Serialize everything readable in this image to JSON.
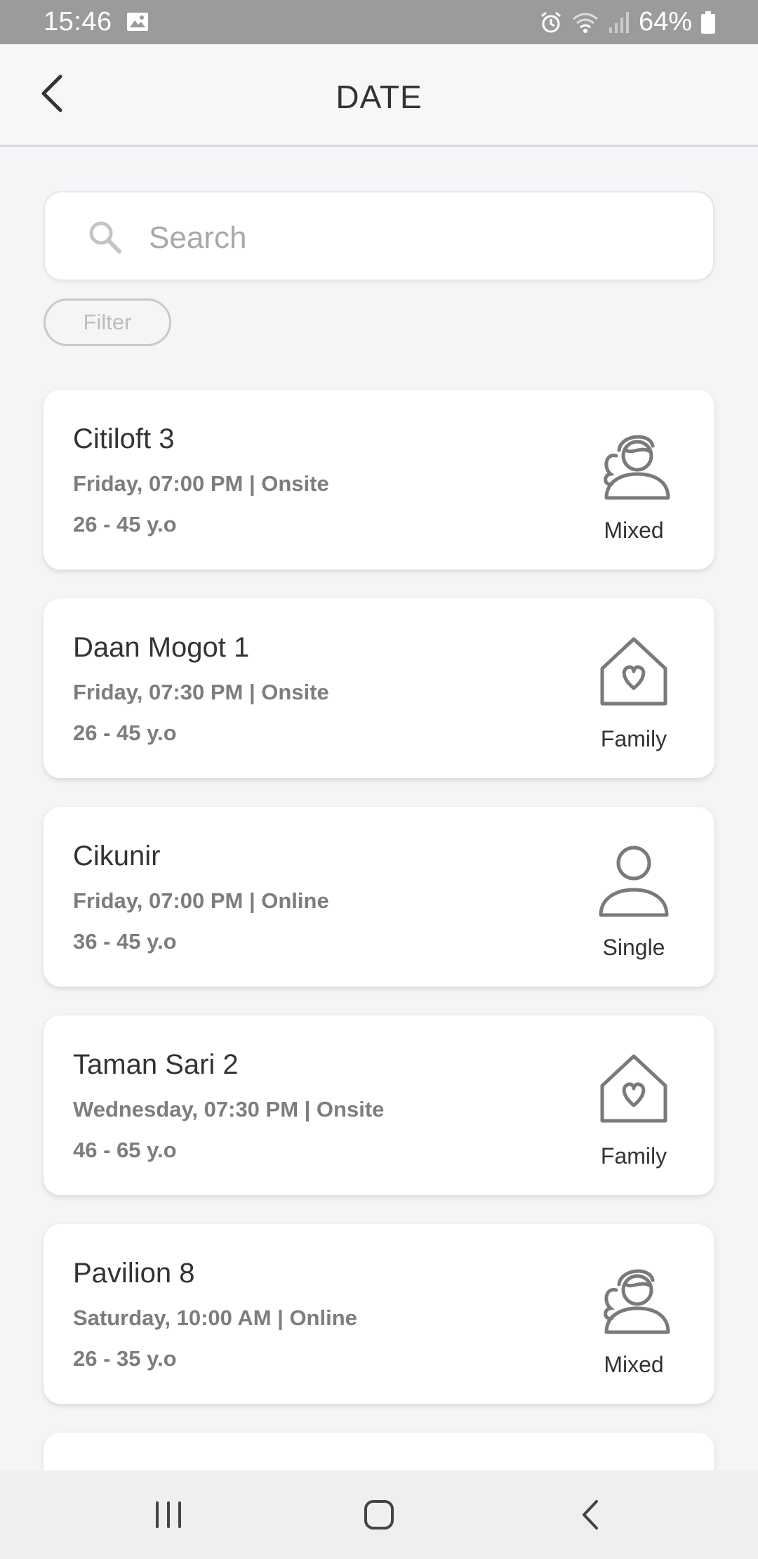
{
  "status_bar": {
    "time": "15:46",
    "battery": "64%",
    "icons": [
      "image-icon",
      "alarm-icon",
      "wifi-icon",
      "signal-icon",
      "battery-icon"
    ]
  },
  "header": {
    "title": "DATE"
  },
  "search": {
    "placeholder": "Search"
  },
  "filter": {
    "label": "Filter"
  },
  "groups": [
    {
      "name": "Citiloft 3",
      "schedule": "Friday, 07:00 PM | Onsite",
      "age": "26 - 45 y.o",
      "type": "Mixed",
      "icon": "mixed-icon"
    },
    {
      "name": "Daan Mogot 1",
      "schedule": "Friday, 07:30 PM | Onsite",
      "age": "26 - 45 y.o",
      "type": "Family",
      "icon": "family-icon"
    },
    {
      "name": "Cikunir",
      "schedule": "Friday, 07:00 PM | Online",
      "age": "36 - 45 y.o",
      "type": "Single",
      "icon": "single-icon"
    },
    {
      "name": "Taman Sari 2",
      "schedule": "Wednesday, 07:30 PM | Onsite",
      "age": "46 - 65 y.o",
      "type": "Family",
      "icon": "family-icon"
    },
    {
      "name": "Pavilion 8",
      "schedule": "Saturday, 10:00 AM | Online",
      "age": "26 - 35 y.o",
      "type": "Mixed",
      "icon": "mixed-icon"
    }
  ],
  "colors": {
    "status_bar": "#9b9b9b",
    "background": "#f4f5f7",
    "card": "#ffffff",
    "icon_stroke": "#7a7a7a"
  },
  "nav_bar": {
    "buttons": [
      "recent-apps-icon",
      "home-icon",
      "back-icon"
    ]
  }
}
